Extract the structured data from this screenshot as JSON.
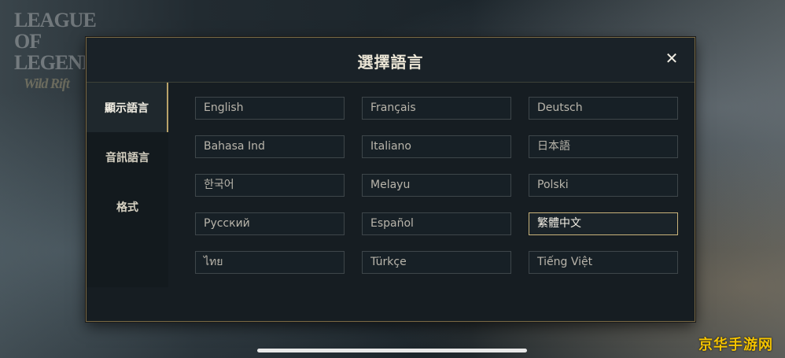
{
  "dialog": {
    "title": "選擇語言",
    "close_glyph": "✕"
  },
  "sidebar": {
    "items": [
      {
        "label": "顯示語言",
        "active": true
      },
      {
        "label": "音訊語言",
        "active": false
      },
      {
        "label": "格式",
        "active": false
      }
    ]
  },
  "languages": [
    {
      "label": "English"
    },
    {
      "label": "Français"
    },
    {
      "label": "Deutsch"
    },
    {
      "label": "Bahasa Ind"
    },
    {
      "label": "Italiano"
    },
    {
      "label": "日本語"
    },
    {
      "label": "한국어"
    },
    {
      "label": "Melayu"
    },
    {
      "label": "Polski"
    },
    {
      "label": "Русский"
    },
    {
      "label": "Español"
    },
    {
      "label": "繁體中文",
      "selected": true
    },
    {
      "label": "ไทย"
    },
    {
      "label": "Türkçe"
    },
    {
      "label": "Tiếng Việt"
    }
  ],
  "background": {
    "logo_text": "LEAGUE OF LEGENDS",
    "logo_subtitle": "Wild Rift"
  },
  "watermark": "京华手游网",
  "colors": {
    "accent_gold": "#c8b27a",
    "panel_bg": "#161d22",
    "watermark_yellow": "#f5c400"
  }
}
